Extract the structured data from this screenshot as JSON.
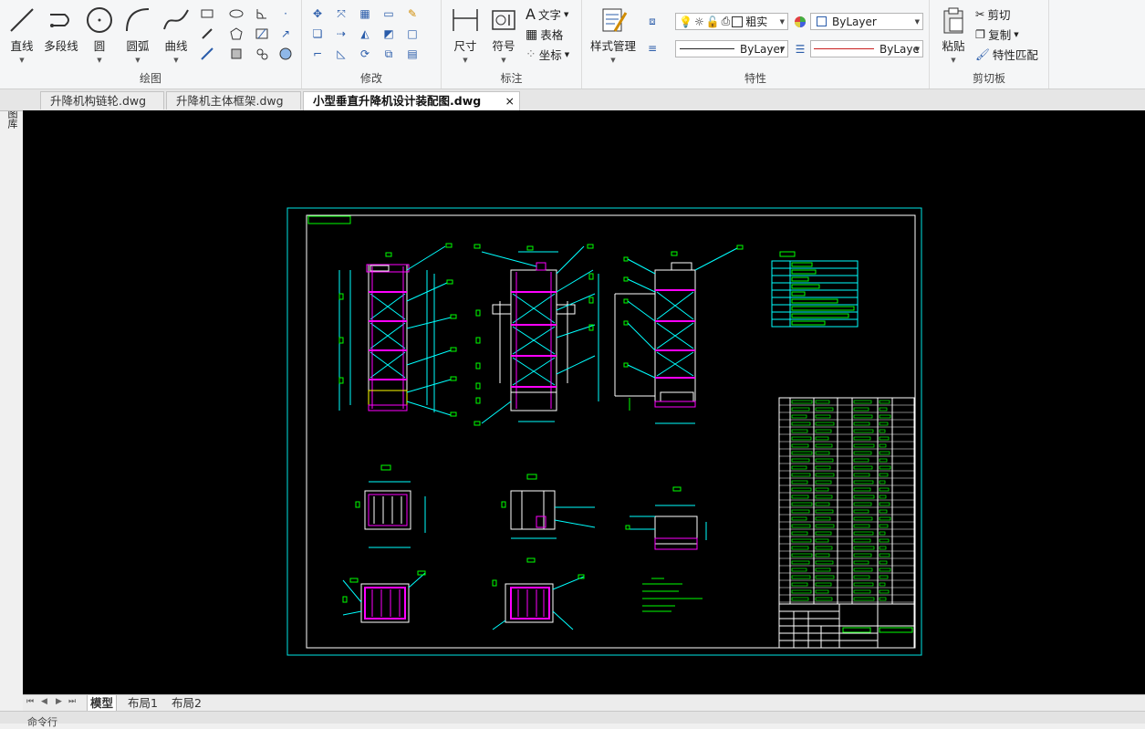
{
  "ribbon": {
    "draw": {
      "title": "绘图",
      "line": "直线",
      "polyline": "多段线",
      "circle": "圆",
      "arc": "圆弧",
      "curve": "曲线"
    },
    "modify": {
      "title": "修改"
    },
    "annotate": {
      "title": "标注",
      "dimension": "尺寸",
      "symbol": "符号",
      "text": "文字",
      "table": "表格",
      "coordinate": "坐标"
    },
    "properties": {
      "title": "特性",
      "style_manager": "样式管理",
      "layer_value": "粗实",
      "color_value": "ByLayer",
      "linetype_value": "ByLayer",
      "lineweight_value": "ByLaye"
    },
    "clipboard": {
      "title": "剪切板",
      "paste": "粘贴",
      "cut": "剪切",
      "copy": "复制",
      "match_props": "特性匹配"
    }
  },
  "sidebar": {
    "label": "图库"
  },
  "tabs": [
    {
      "label": "升降机构链轮.dwg"
    },
    {
      "label": "升降机主体框架.dwg"
    },
    {
      "label": "小型垂直升降机设计装配图.dwg"
    }
  ],
  "layout_tabs": [
    "模型",
    "布局1",
    "布局2"
  ],
  "command_line": {
    "prompt": "命令行"
  },
  "colors": {
    "canvas": "#000000",
    "cyan": "#00ffff",
    "magenta": "#ff00ff",
    "green": "#00ff00",
    "white": "#ffffff",
    "red_line": "#c81e1e",
    "ribbon_bg": "#f5f6f7"
  }
}
